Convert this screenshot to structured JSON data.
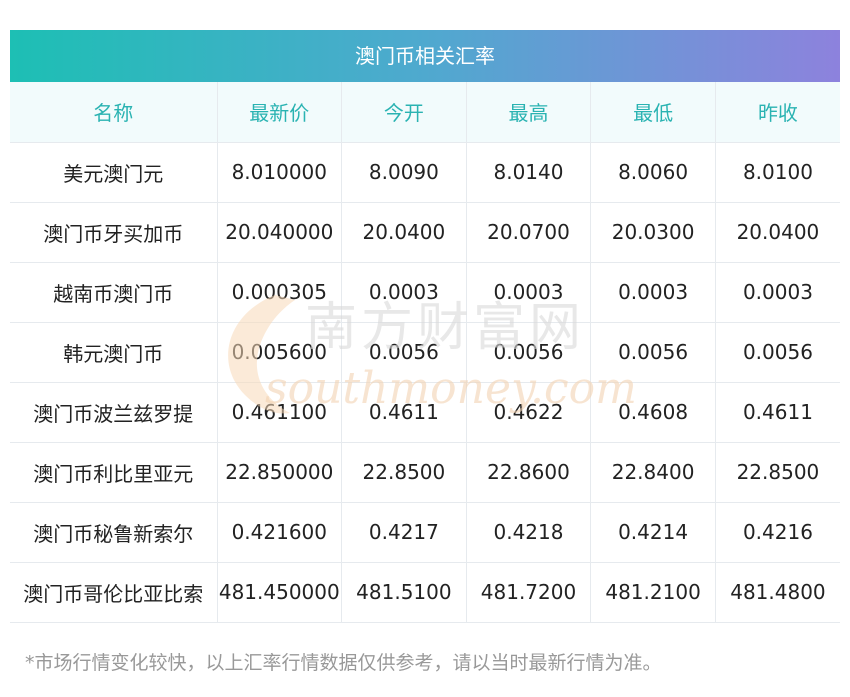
{
  "title": "澳门币相关汇率",
  "headers": [
    "名称",
    "最新价",
    "今开",
    "最高",
    "最低",
    "昨收"
  ],
  "rows": [
    [
      "美元澳门元",
      "8.010000",
      "8.0090",
      "8.0140",
      "8.0060",
      "8.0100"
    ],
    [
      "澳门币牙买加币",
      "20.040000",
      "20.0400",
      "20.0700",
      "20.0300",
      "20.0400"
    ],
    [
      "越南币澳门币",
      "0.000305",
      "0.0003",
      "0.0003",
      "0.0003",
      "0.0003"
    ],
    [
      "韩元澳门币",
      "0.005600",
      "0.0056",
      "0.0056",
      "0.0056",
      "0.0056"
    ],
    [
      "澳门币波兰兹罗提",
      "0.461100",
      "0.4611",
      "0.4622",
      "0.4608",
      "0.4611"
    ],
    [
      "澳门币利比里亚元",
      "22.850000",
      "22.8500",
      "22.8600",
      "22.8400",
      "22.8500"
    ],
    [
      "澳门币秘鲁新索尔",
      "0.421600",
      "0.4217",
      "0.4218",
      "0.4214",
      "0.4216"
    ],
    [
      "澳门币哥伦比亚比索",
      "481.450000",
      "481.5100",
      "481.7200",
      "481.2100",
      "481.4800"
    ]
  ],
  "watermark": {
    "text_cn": "南方财富网",
    "text_en": "southmoney.com"
  },
  "footnote": "*市场行情变化较快，以上汇率行情数据仅供参考，请以当时最新行情为准。",
  "colors": {
    "gradient_start": "#1dbfb4",
    "gradient_end": "#8d82dd",
    "header_text": "#2ab3b2",
    "header_bg": "#f2fbfc"
  }
}
